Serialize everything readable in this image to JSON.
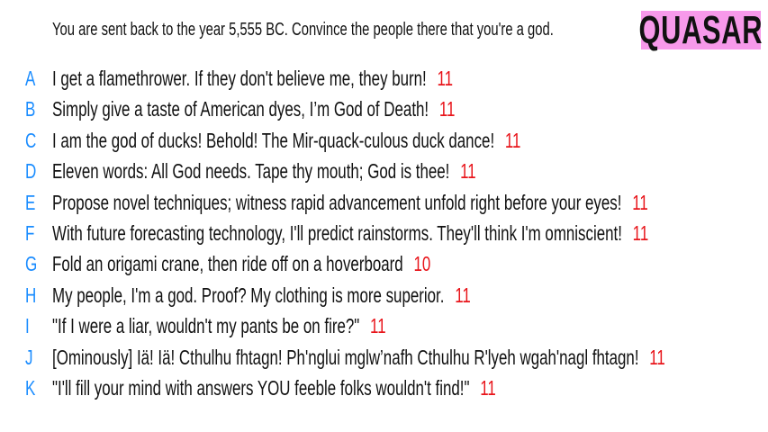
{
  "question": "You are sent back to the year 5,555 BC. Convince the people there that you're a god.",
  "logo": "QUASAR",
  "colors": {
    "letter": "#1a8cff",
    "score": "#e8141a",
    "logo_bg": "#f799ea"
  },
  "answers": [
    {
      "letter": "A",
      "text": "I get a flamethrower. If they don't believe me, they burn!",
      "score": "11"
    },
    {
      "letter": "B",
      "text": "Simply give a taste of American dyes, I’m God of Death!",
      "score": "11"
    },
    {
      "letter": "C",
      "text": "I am the god of ducks! Behold! The Mir-quack-culous duck dance!",
      "score": "11"
    },
    {
      "letter": "D",
      "text": "Eleven words: All God needs. Tape thy mouth; God is thee!",
      "score": "11"
    },
    {
      "letter": "E",
      "text": "Propose novel techniques; witness rapid advancement unfold right before your eyes!",
      "score": "11"
    },
    {
      "letter": "F",
      "text": "With future forecasting technology, I'll predict rainstorms. They'll think I'm omniscient!",
      "score": "11"
    },
    {
      "letter": "G",
      "text": "Fold an origami crane, then ride off on a hoverboard",
      "score": "10"
    },
    {
      "letter": "H",
      "text": "My people, I'm a god. Proof? My clothing is more superior.",
      "score": "11"
    },
    {
      "letter": "I",
      "text": "\"If I were a liar, wouldn't my pants be on fire?\"",
      "score": "11"
    },
    {
      "letter": "J",
      "text": "[Ominously] Iä! Iä! Cthulhu fhtagn! Ph'nglui mglw’nafh Cthulhu R'lyeh wgah'nagl fhtagn!",
      "score": "11"
    },
    {
      "letter": "K",
      "text": "\"I'll fill your mind with answers YOU feeble folks wouldn't find!\"",
      "score": "11"
    }
  ]
}
